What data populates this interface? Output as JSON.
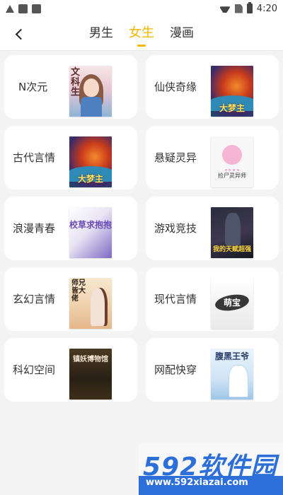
{
  "status_bar": {
    "time": "4:20",
    "icons": [
      "warning-icon",
      "app-square-icon",
      "app-square-icon",
      "wifi-icon",
      "no-sim-icon",
      "battery-icon"
    ]
  },
  "header": {
    "back_icon": "chevron-left-icon",
    "tabs": [
      {
        "label": "男生",
        "active": false
      },
      {
        "label": "女生",
        "active": true
      },
      {
        "label": "漫画",
        "active": false
      }
    ],
    "accent_color": "#f2b600"
  },
  "categories": [
    {
      "label": "N次元",
      "cover_text": "文科生"
    },
    {
      "label": "仙侠奇缘",
      "cover_text": "大梦主"
    },
    {
      "label": "古代言情",
      "cover_text": "大梦主"
    },
    {
      "label": "悬疑灵异",
      "cover_text": "捡尸灵异师"
    },
    {
      "label": "浪漫青春",
      "cover_text": "校草求抱抱"
    },
    {
      "label": "游戏竞技",
      "cover_text": "我的天赋超强"
    },
    {
      "label": "玄幻言情",
      "cover_text": "师兄皆大佬"
    },
    {
      "label": "现代言情",
      "cover_text": "萌宝"
    },
    {
      "label": "科幻空间",
      "cover_text": "镇妖博物馆"
    },
    {
      "label": "网配快穿",
      "cover_text": "腹黑王爷"
    }
  ],
  "watermark": {
    "text": "592软件园",
    "url": "www.592xiazai.com"
  }
}
